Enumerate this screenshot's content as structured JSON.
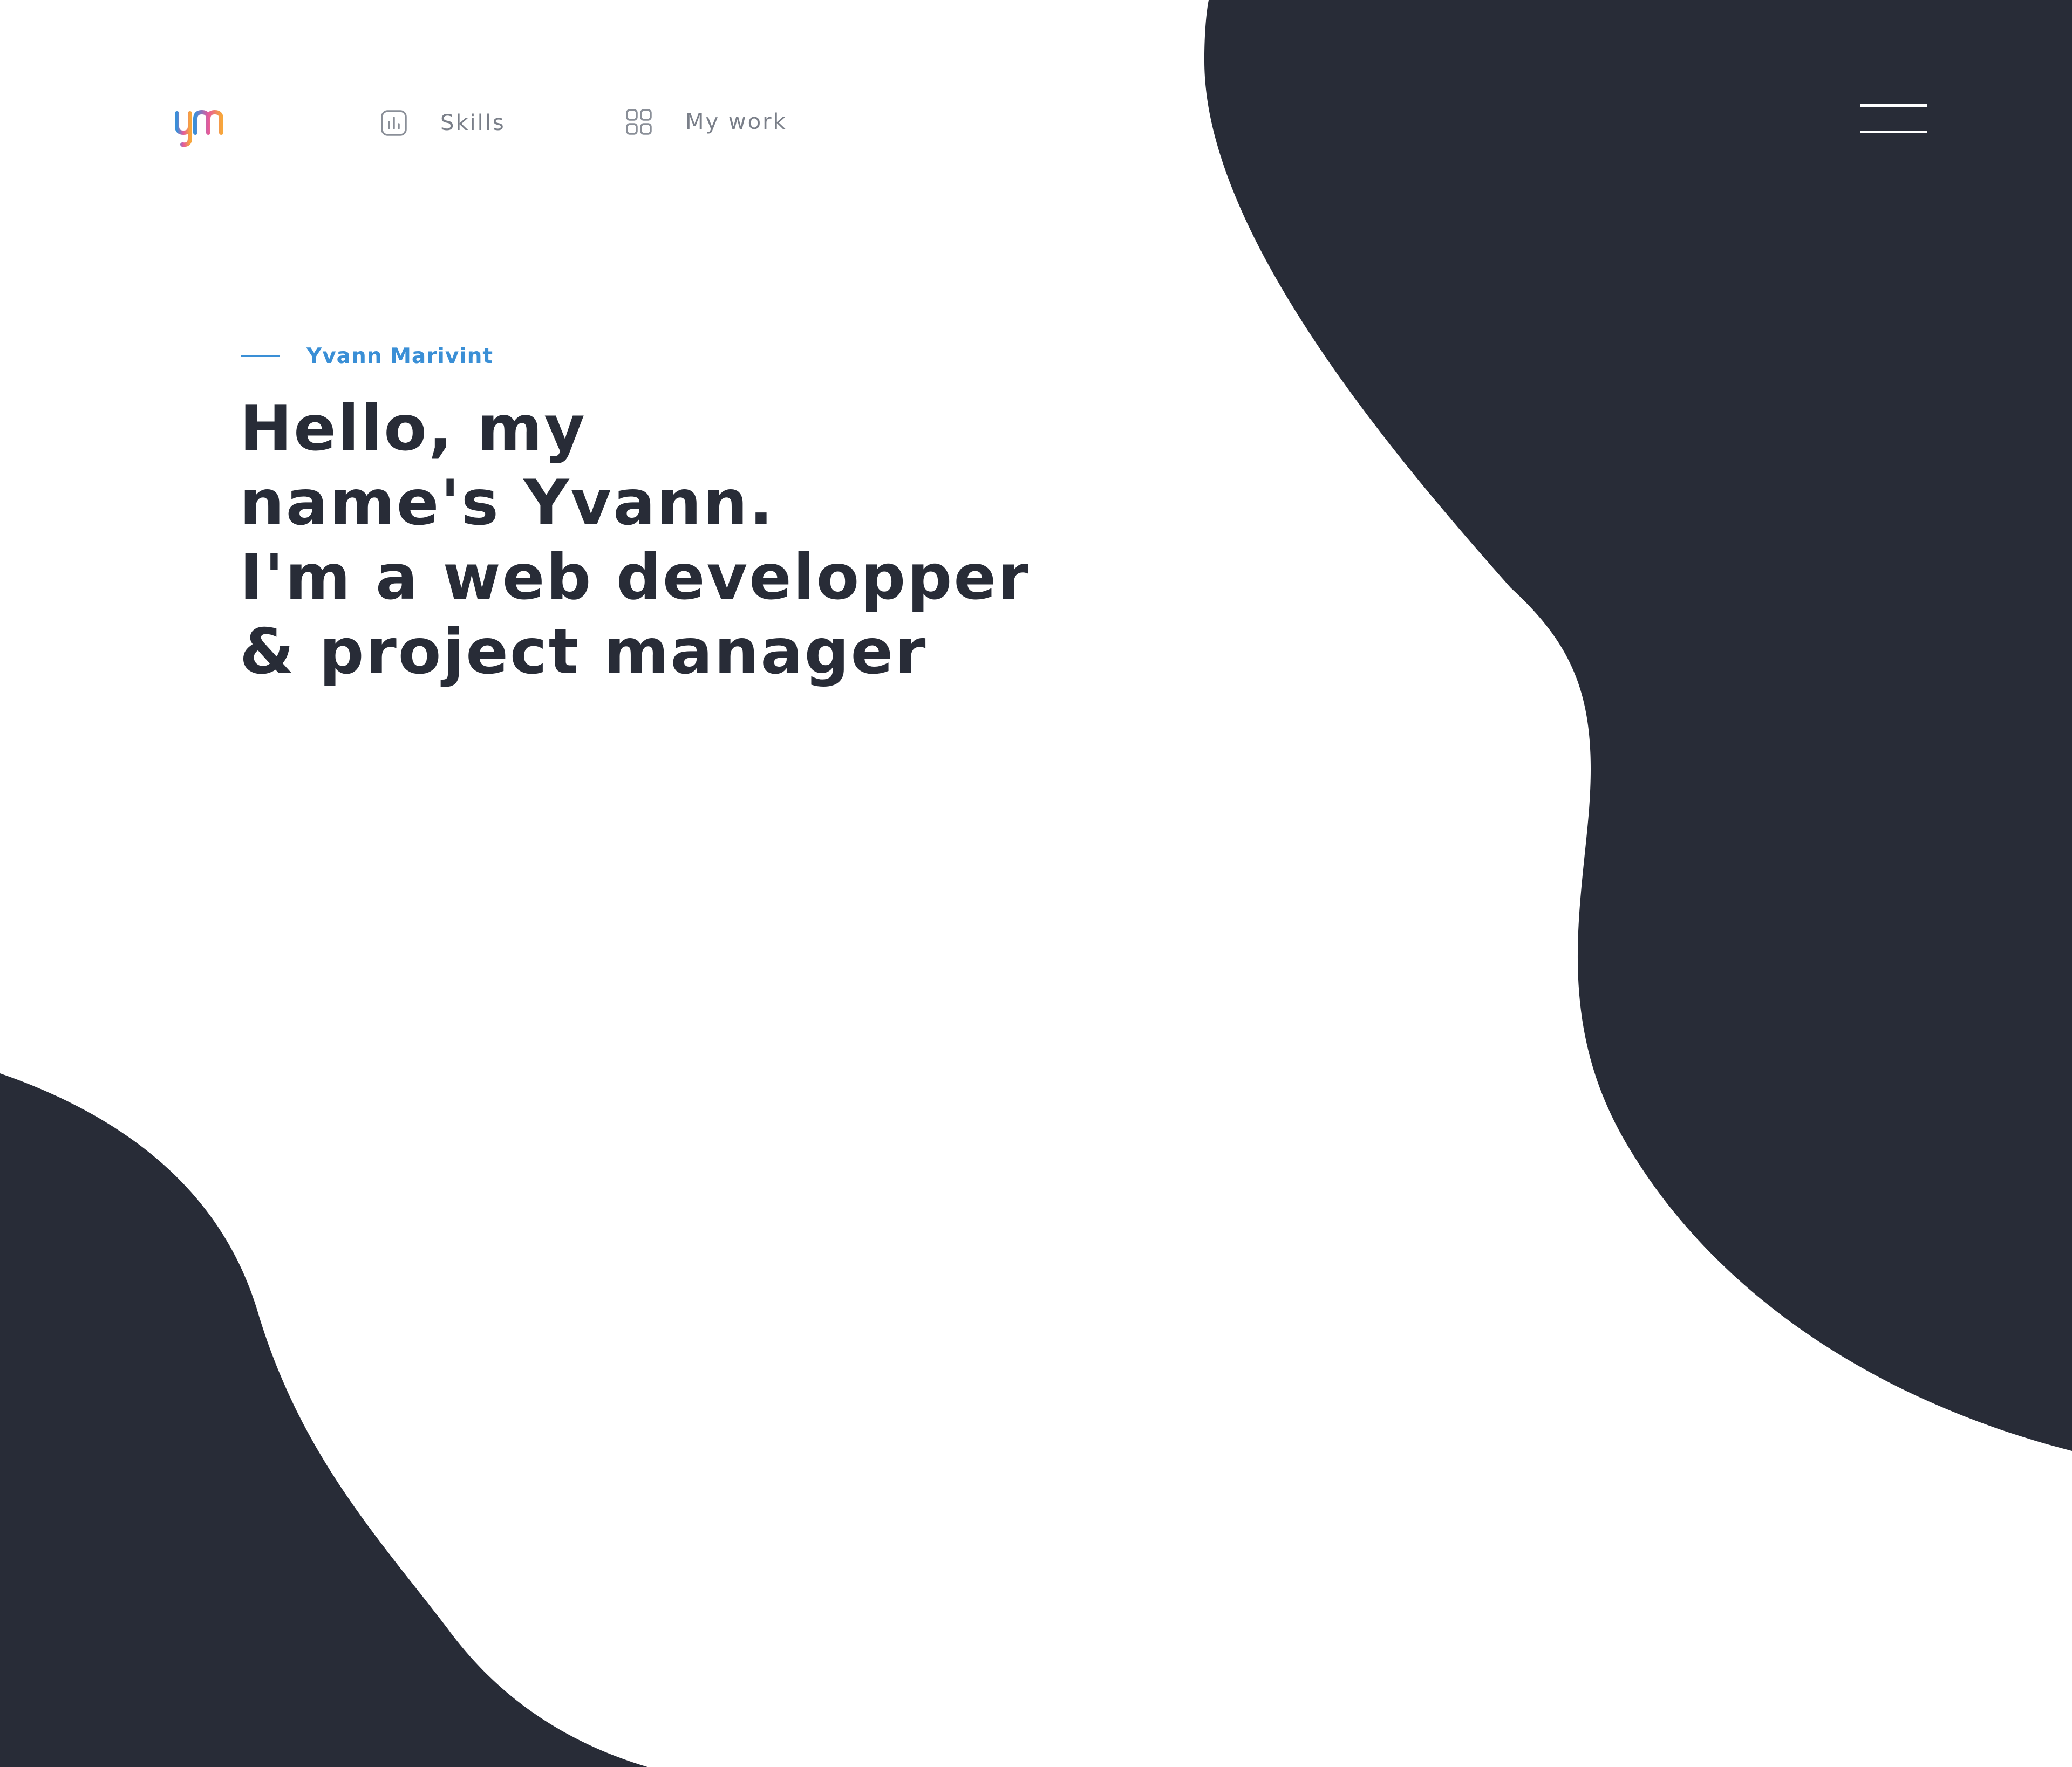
{
  "logo": {
    "text": "ym",
    "gradient": [
      "#3b8fd8",
      "#e65a9c",
      "#f7a63c"
    ]
  },
  "nav": {
    "items": [
      {
        "label": "Skills",
        "icon": "bar-chart-icon"
      },
      {
        "label": "My work",
        "icon": "grid-icon"
      }
    ],
    "menu_icon": "hamburger-icon"
  },
  "hero": {
    "name": "Yvann Marivint",
    "lines": [
      "Hello, my",
      "name's Yvann.",
      "I'm a web developper",
      "& project manager"
    ]
  },
  "colors": {
    "dark": "#282c37",
    "accent": "#3a8fd6",
    "muted": "#7a7f89",
    "background": "#ffffff"
  }
}
